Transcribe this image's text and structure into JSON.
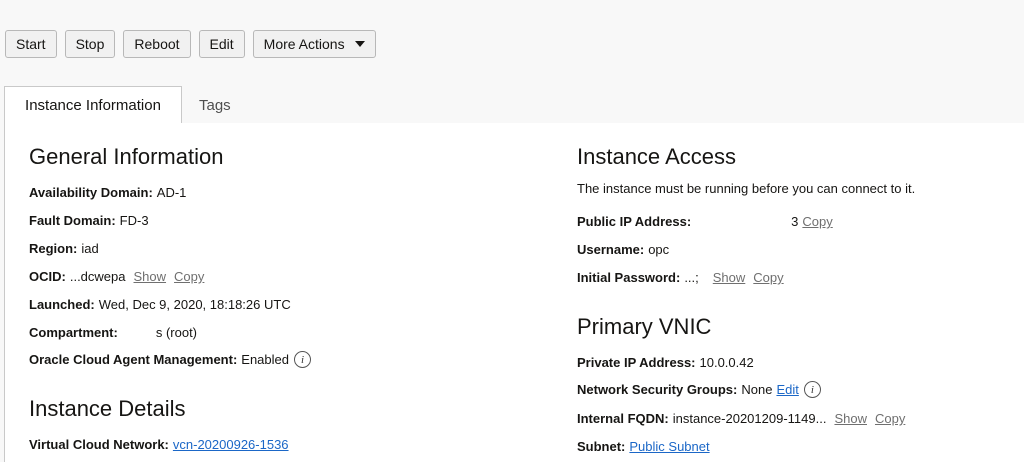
{
  "toolbar": {
    "start": "Start",
    "stop": "Stop",
    "reboot": "Reboot",
    "edit": "Edit",
    "more_actions": "More Actions"
  },
  "tabs": [
    {
      "label": "Instance Information",
      "active": true
    },
    {
      "label": "Tags",
      "active": false
    }
  ],
  "general": {
    "title": "General Information",
    "availability_domain": {
      "key": "Availability Domain:",
      "value": "AD-1"
    },
    "fault_domain": {
      "key": "Fault Domain:",
      "value": "FD-3"
    },
    "region": {
      "key": "Region:",
      "value": "iad"
    },
    "ocid": {
      "key": "OCID:",
      "value": "...dcwepa",
      "show": "Show",
      "copy": "Copy"
    },
    "launched": {
      "key": "Launched:",
      "value": "Wed, Dec 9, 2020, 18:18:26 UTC"
    },
    "compartment": {
      "key": "Compartment:",
      "value": "s (root)"
    },
    "agent": {
      "key": "Oracle Cloud Agent Management:",
      "value": "Enabled"
    }
  },
  "instance_details": {
    "title": "Instance Details",
    "vcn": {
      "key": "Virtual Cloud Network:",
      "value": "vcn-20200926-1536"
    }
  },
  "access": {
    "title": "Instance Access",
    "description": "The instance must be running before you can connect to it.",
    "public_ip": {
      "key": "Public IP Address:",
      "value": "3",
      "copy": "Copy"
    },
    "username": {
      "key": "Username:",
      "value": "opc"
    },
    "password": {
      "key": "Initial Password:",
      "value": "...;",
      "show": "Show",
      "copy": "Copy"
    }
  },
  "vnic": {
    "title": "Primary VNIC",
    "private_ip": {
      "key": "Private IP Address:",
      "value": "10.0.0.42"
    },
    "nsg": {
      "key": "Network Security Groups:",
      "value": "None",
      "edit": "Edit"
    },
    "fqdn": {
      "key": "Internal FQDN:",
      "value": "instance-20201209-1149...",
      "show": "Show",
      "copy": "Copy"
    },
    "subnet": {
      "key": "Subnet:",
      "value": "Public Subnet"
    }
  },
  "icons": {
    "info": "info-icon",
    "caret": "caret-down-icon"
  },
  "colors": {
    "link": "#1b67c7",
    "muted_link": "#6f6f6f"
  }
}
